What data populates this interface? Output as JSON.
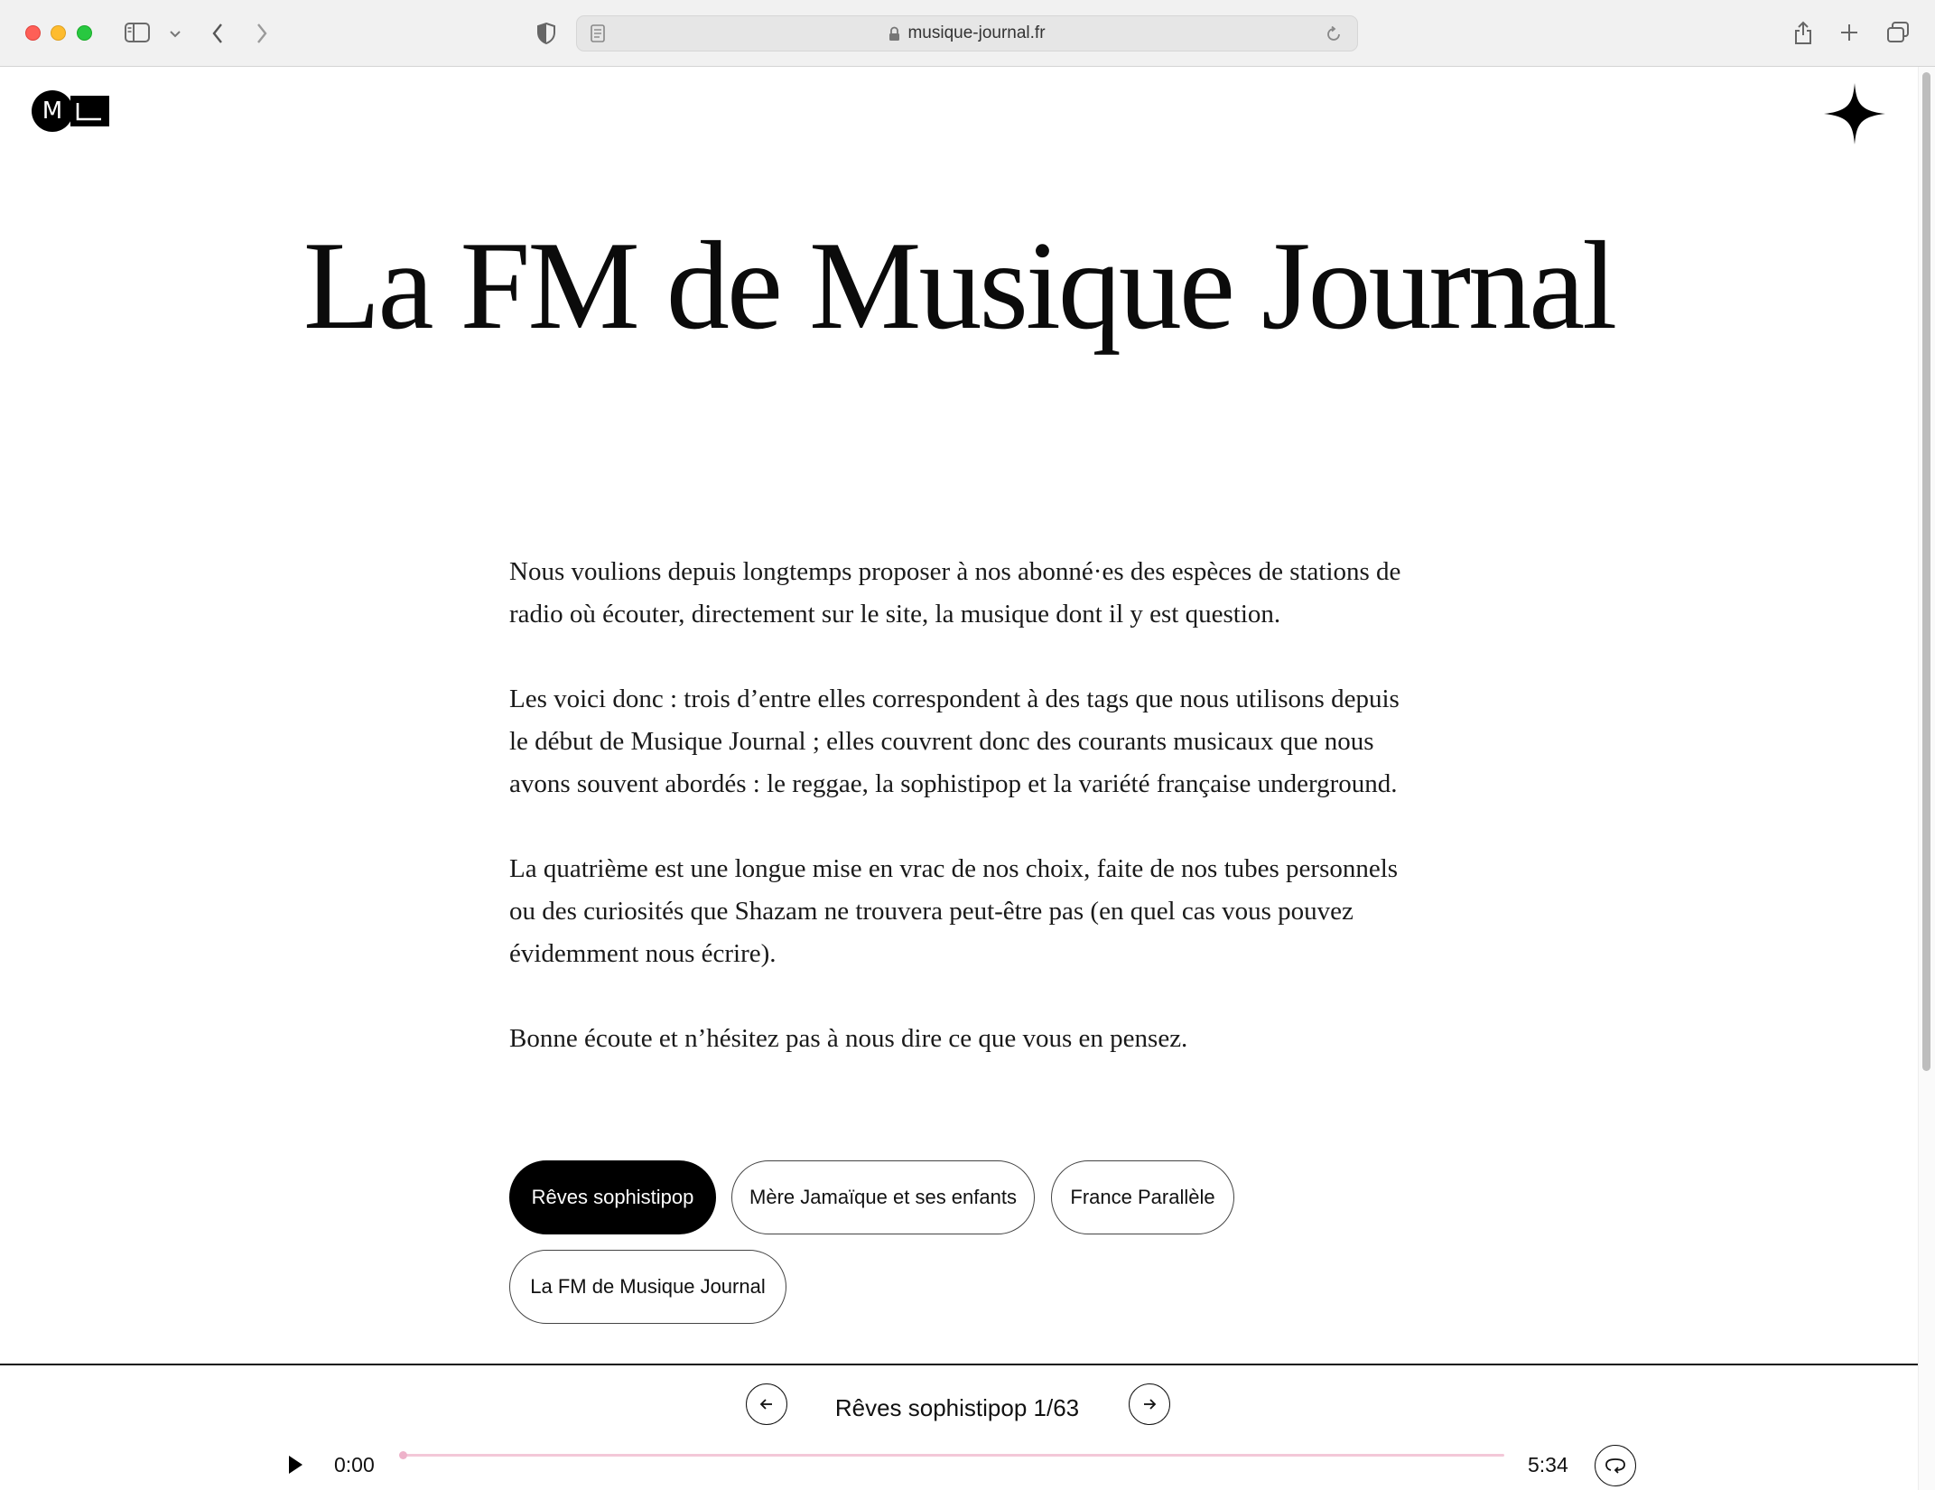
{
  "browser": {
    "url": "musique-journal.fr"
  },
  "site": {
    "logo_letter": "M"
  },
  "article": {
    "title": "La FM de Musique Journal",
    "paragraphs": [
      "Nous voulions depuis longtemps proposer à nos abonné·es des espèces de stations de radio où écouter, directement sur le site, la musique dont il y est question.",
      "Les voici donc : trois d’entre elles correspondent à des tags que nous utilisons depuis le début de Musique Journal ; elles couvrent donc des courants musicaux que nous avons souvent abordés : le reggae, la sophistipop et la variété française underground.",
      "La quatrième est une longue mise en vrac de nos choix, faite de nos tubes personnels ou des curiosités que Shazam ne trouvera peut-être pas (en quel cas vous pouvez évidemment nous écrire).",
      "Bonne écoute et n’hésitez pas à nous dire ce que vous en pensez."
    ]
  },
  "stations": [
    {
      "label": "Rêves sophistipop",
      "active": true
    },
    {
      "label": "Mère Jamaïque et ses enfants",
      "active": false
    },
    {
      "label": "France Parallèle",
      "active": false
    },
    {
      "label": "La FM de Musique Journal",
      "active": false
    }
  ],
  "player": {
    "track_label": "Rêves sophistipop 1/63",
    "current_time": "0:00",
    "duration": "5:34",
    "progress_fraction": 0
  },
  "icons": {
    "sidebar": "sidebar-icon",
    "back": "chevron-left-icon",
    "forward": "chevron-right-icon",
    "shield": "privacy-shield-icon",
    "lock": "lock-icon",
    "reload": "reload-icon",
    "share": "share-icon",
    "new_tab": "plus-icon",
    "tabs": "tabs-overview-icon",
    "sparkle": "sparkle-icon",
    "play": "play-icon",
    "prev": "arrow-left-icon",
    "next": "arrow-right-icon",
    "loop": "loop-icon"
  },
  "colors": {
    "accent_progress": "#f3c8d8",
    "active_chip": "#000000"
  }
}
